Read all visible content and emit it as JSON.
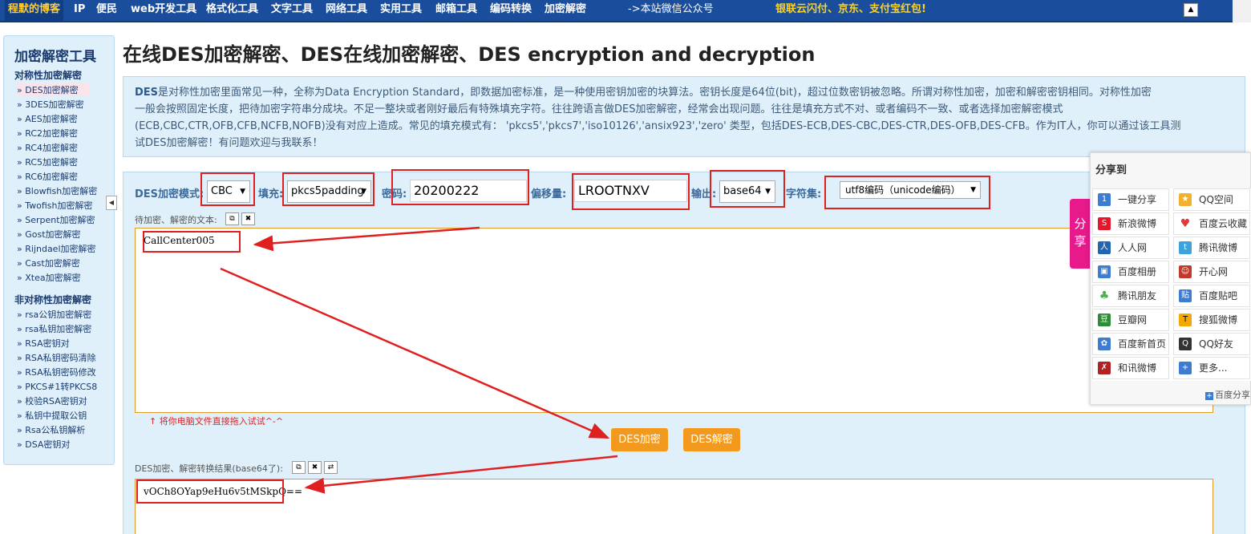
{
  "topnav": {
    "items": [
      "程默的博客",
      "IP",
      "便民",
      "web开发工具",
      "格式化工具",
      "文字工具",
      "网络工具",
      "实用工具",
      "邮箱工具",
      "编码转换",
      "加密解密"
    ],
    "wechat": "->本站微信公众号",
    "promo": "银联云闪付、京东、支付宝红包!"
  },
  "sidebar": {
    "title": "加密解密工具",
    "symmetric_heading": "对称性加密解密",
    "symmetric": [
      "DES加密解密",
      "3DES加密解密",
      "AES加密解密",
      "RC2加密解密",
      "RC4加密解密",
      "RC5加密解密",
      "RC6加密解密",
      "Blowfish加密解密",
      "Twofish加密解密",
      "Serpent加密解密",
      "Gost加密解密",
      "Rijndael加密解密",
      "Cast加密解密",
      "Xtea加密解密"
    ],
    "asymmetric_heading": "非对称性加密解密",
    "asymmetric": [
      "rsa公钥加密解密",
      "rsa私钥加密解密",
      "RSA密钥对",
      "RSA私钥密码清除",
      "RSA私钥密码修改",
      "PKCS#1转PKCS8",
      "校验RSA密钥对",
      "私钥中提取公钥",
      "Rsa公私钥解析",
      "DSA密钥对"
    ],
    "active": "DES加密解密"
  },
  "page_title": "在线DES加密解密、DES在线加密解密、DES encryption and decryption",
  "description": {
    "lead": "DES",
    "line1": "是对称性加密里面常见一种，全称为Data Encryption Standard，即数据加密标准，是一种使用密钥加密的块算法。密钥长度是64位(bit)，超过位数密钥被忽略。所谓对称性加密，加密和解密密钥相同。对称性加密",
    "line2": "一般会按照固定长度，把待加密字符串分成块。不足一整块或者刚好最后有特殊填充字符。往往跨语言做DES加密解密，经常会出现问题。往往是填充方式不对、或者编码不一致、或者选择加密解密模式",
    "line3": "(ECB,CBC,CTR,OFB,CFB,NCFB,NOFB)没有对应上造成。常见的填充模式有：  'pkcs5','pkcs7','iso10126','ansix923','zero' 类型，包括DES-ECB,DES-CBC,DES-CTR,DES-OFB,DES-CFB。作为IT人，你可以通过该工具测",
    "line4": "试DES加密解密！有问题欢迎与我联系！"
  },
  "form": {
    "mode_label": "DES加密模式:",
    "mode_value": "CBC",
    "padding_label": "填充:",
    "padding_value": "pkcs5padding",
    "key_label": "密码:",
    "key_value": "20200222",
    "iv_label": "偏移量:",
    "iv_value": "LROOTNXV",
    "output_label": "输出:",
    "output_value": "base64",
    "charset_label": "字符集:",
    "charset_value": "utf8编码（unicode编码）",
    "input_label": "待加密、解密的文本:",
    "input_text": "CallCenter005",
    "drag_hint": "↑ 将你电脑文件直接拖入试试^-^",
    "encrypt_button": "DES加密",
    "decrypt_button": "DES解密",
    "result_label": "DES加密、解密转换结果(base64了):",
    "result_text": "vOCh8OYap9eHu6v5tMSkpQ=="
  },
  "share": {
    "title": "分享到",
    "tab": "分享",
    "items": [
      {
        "label": "一键分享",
        "icon": "one-click-share-icon",
        "color": "#3c7dd1",
        "glyph": "1"
      },
      {
        "label": "QQ空间",
        "icon": "qzone-icon",
        "color": "#f2b12c",
        "glyph": "★"
      },
      {
        "label": "新浪微博",
        "icon": "sina-weibo-icon",
        "color": "#e6162d",
        "glyph": "S"
      },
      {
        "label": "百度云收藏",
        "icon": "baidu-cloud-icon",
        "color": "#e23a3a",
        "glyph": "♥"
      },
      {
        "label": "人人网",
        "icon": "renren-icon",
        "color": "#2266b2",
        "glyph": "人"
      },
      {
        "label": "腾讯微博",
        "icon": "tencent-weibo-icon",
        "color": "#3fa3db",
        "glyph": "t"
      },
      {
        "label": "百度相册",
        "icon": "baidu-album-icon",
        "color": "#3c7dd1",
        "glyph": "▣"
      },
      {
        "label": "开心网",
        "icon": "kaixin-icon",
        "color": "#c0392b",
        "glyph": "☺"
      },
      {
        "label": "腾讯朋友",
        "icon": "tencent-friends-icon",
        "color": "#4caf50",
        "glyph": "♣"
      },
      {
        "label": "百度贴吧",
        "icon": "baidu-tieba-icon",
        "color": "#3c7dd1",
        "glyph": "贴"
      },
      {
        "label": "豆瓣网",
        "icon": "douban-icon",
        "color": "#2e8b36",
        "glyph": "豆"
      },
      {
        "label": "搜狐微博",
        "icon": "sohu-weibo-icon",
        "color": "#f4a800",
        "glyph": "T"
      },
      {
        "label": "百度新首页",
        "icon": "baidu-home-icon",
        "color": "#3c7dd1",
        "glyph": "✿"
      },
      {
        "label": "QQ好友",
        "icon": "qq-friend-icon",
        "color": "#333333",
        "glyph": "Q"
      },
      {
        "label": "和讯微博",
        "icon": "hexun-weibo-icon",
        "color": "#b22222",
        "glyph": "✗"
      },
      {
        "label": "更多...",
        "icon": "more-icon",
        "color": "#3c7dd1",
        "glyph": "+"
      }
    ],
    "footer": "百度分享"
  }
}
